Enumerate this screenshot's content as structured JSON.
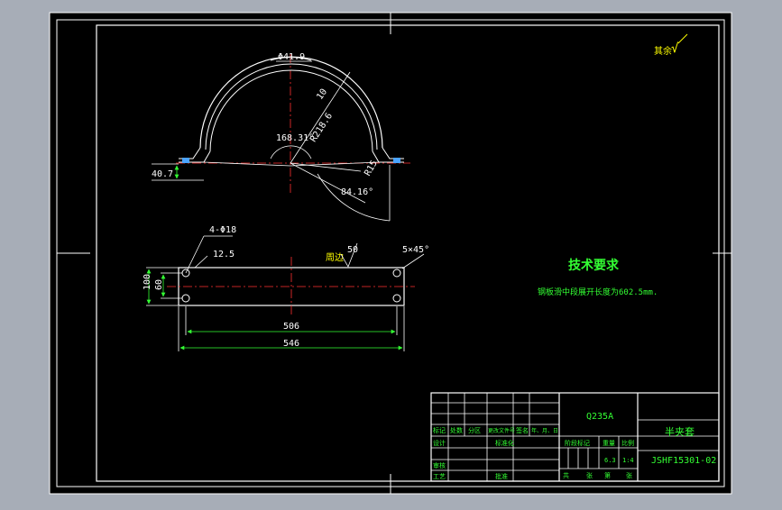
{
  "colors": {
    "background": "#a7adb7",
    "paper": "#000000",
    "line": "#ffffff",
    "dimension": "#33ff33",
    "annotation": "#ffff00",
    "centerline": "#ff3030"
  },
  "roughness": {
    "label": "其余",
    "spec": "√"
  },
  "front_view": {
    "dims": {
      "outer_diameter": "Φ41.9",
      "width": "10",
      "radius": "R218.6",
      "angle_top": "168.31°",
      "height": "40.7",
      "small_radius": "R15",
      "angle_bottom": "84.16°"
    }
  },
  "plan_view": {
    "dims": {
      "holes": "4-Φ18",
      "hole_offset": "12.5",
      "outer_height": "100",
      "hole_spacing_v": "60",
      "hole_spacing_h": "506",
      "total_length": "546",
      "chamfer": "5×45°",
      "edge_note": "周边",
      "roughness_value": "50"
    }
  },
  "tech_requirements": {
    "title": "技术要求",
    "text": "钢板滑中段展开长度为602.5mm."
  },
  "title_block": {
    "material": "Q235A",
    "part_name": "半夹套",
    "drawing_no": "JSHF15301-02",
    "header_labels": [
      "标记",
      "处数",
      "分区",
      "更改文件号",
      "签名",
      "年、月、日"
    ],
    "row_design": "设计",
    "row_standard": "标准化",
    "row_review": "审核",
    "row_process": "工艺",
    "row_approve": "批准",
    "stage_label": "阶段标记",
    "weight_label": "重量",
    "scale_label": "比例",
    "weight": "6.3",
    "scale": "1:4",
    "sheets_total": "共",
    "sheet_unit": "张",
    "sheet_no": "第",
    "sheet_unit2": "张"
  }
}
